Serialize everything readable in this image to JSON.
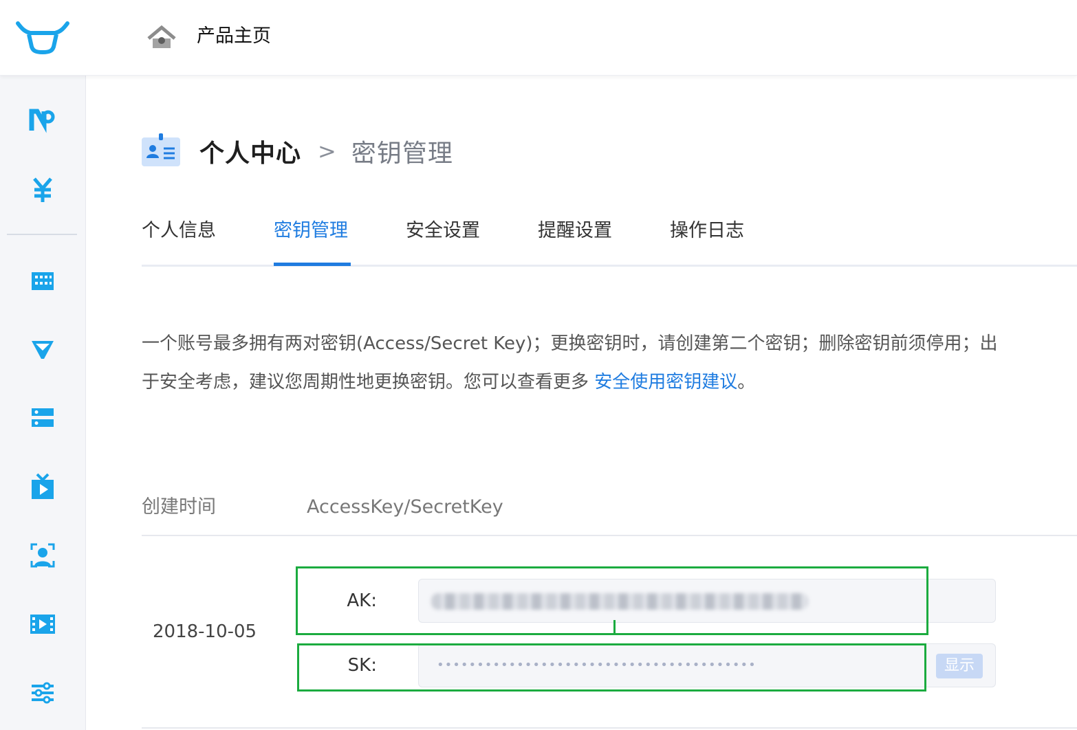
{
  "header": {
    "title": "产品主页"
  },
  "sidebar": {
    "icons": [
      "n-product-icon",
      "yuan-icon",
      "grid-icon",
      "funnel-icon",
      "database-icon",
      "tv-icon",
      "face-scan-icon",
      "video-icon",
      "sliders-icon"
    ]
  },
  "breadcrumb": {
    "root": "个人中心",
    "separator": ">",
    "current": "密钥管理"
  },
  "tabs": [
    {
      "label": "个人信息",
      "active": false
    },
    {
      "label": "密钥管理",
      "active": true
    },
    {
      "label": "安全设置",
      "active": false
    },
    {
      "label": "提醒设置",
      "active": false
    },
    {
      "label": "操作日志",
      "active": false
    }
  ],
  "notice": {
    "text": "一个账号最多拥有两对密钥(Access/Secret Key)；更换密钥时，请创建第二个密钥；删除密钥前须停用；出于安全考虑，建议您周期性地更换密钥。您可以查看更多 ",
    "link": "安全使用密钥建议",
    "suffix": "。"
  },
  "table": {
    "columns": [
      "创建时间",
      "AccessKey/SecretKey"
    ],
    "rows": [
      {
        "created": "2018-10-05",
        "ak_label": "AK:",
        "sk_label": "SK:",
        "sk_masked": "••••••••••••••••••••••••••••••••••••••••",
        "show_label": "显示"
      }
    ]
  },
  "colors": {
    "accent": "#1f7ce0",
    "highlight": "#1bab3f",
    "icon_blue": "#1aa4ea"
  }
}
